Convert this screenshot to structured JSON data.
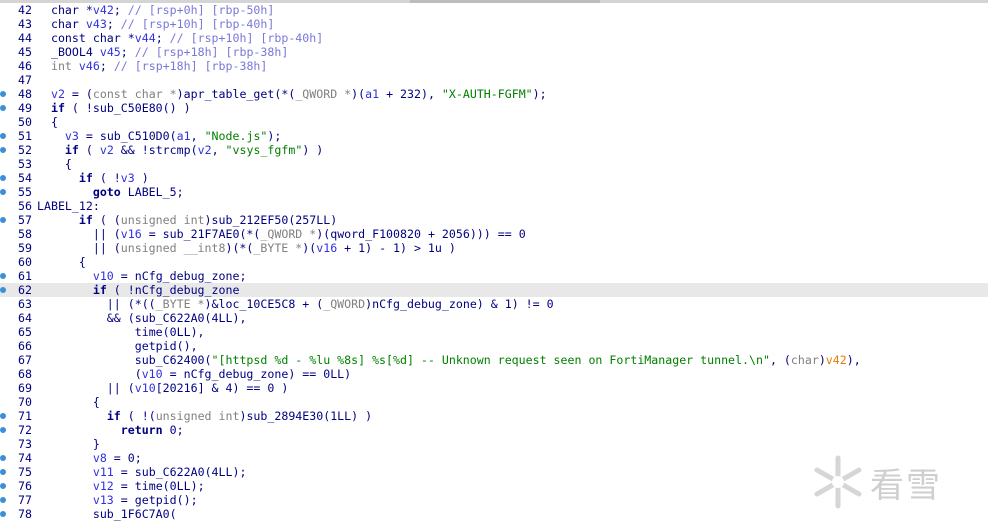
{
  "editor": {
    "watermark_text": "看雪",
    "lines": [
      {
        "n": "42",
        "bp": false,
        "hl": false,
        "html": "  <span class=\"ty\">char</span> *<span class=\"var\">v42</span>; <span class=\"cmt\">// [rsp+0h] [rbp-50h]</span>"
      },
      {
        "n": "43",
        "bp": false,
        "hl": false,
        "html": "  <span class=\"ty\">char</span> <span class=\"var\">v43</span>; <span class=\"cmt\">// [rsp+10h] [rbp-40h]</span>"
      },
      {
        "n": "44",
        "bp": false,
        "hl": false,
        "html": "  <span class=\"ty\">const char</span> *<span class=\"var\">v44</span>; <span class=\"cmt\">// [rsp+10h] [rbp-40h]</span>"
      },
      {
        "n": "45",
        "bp": false,
        "hl": false,
        "html": "  <span class=\"ty\">_BOOL4</span> <span class=\"var\">v45</span>; <span class=\"cmt\">// [rsp+18h] [rbp-38h]</span>"
      },
      {
        "n": "46",
        "bp": false,
        "hl": false,
        "html": "  <span class=\"gray\">int</span> <span class=\"var\">v46</span>; <span class=\"cmt\">// [rsp+18h] [rbp-38h]</span>"
      },
      {
        "n": "47",
        "bp": false,
        "hl": false,
        "html": ""
      },
      {
        "n": "48",
        "bp": true,
        "hl": false,
        "html": "  <span class=\"var\">v2</span> = (<span class=\"gray\">const char *</span>)<span class=\"fn\">apr_table_get</span>(*(<span class=\"gray\">_QWORD *</span>)(<span class=\"arg\">a1</span> + 232), <span class=\"str\">\"X-AUTH-FGFM\"</span>);"
      },
      {
        "n": "49",
        "bp": true,
        "hl": false,
        "html": "  <span class=\"kw\">if</span> ( !<span class=\"fn\">sub_C50E80</span>() )"
      },
      {
        "n": "50",
        "bp": false,
        "hl": false,
        "html": "  {"
      },
      {
        "n": "51",
        "bp": true,
        "hl": false,
        "html": "    <span class=\"var\">v3</span> = <span class=\"fn\">sub_C510D0</span>(<span class=\"arg\">a1</span>, <span class=\"str\">\"Node.js\"</span>);"
      },
      {
        "n": "52",
        "bp": true,
        "hl": false,
        "html": "    <span class=\"kw\">if</span> ( <span class=\"var\">v2</span> &amp;&amp; !<span class=\"fn\">strcmp</span>(<span class=\"var\">v2</span>, <span class=\"str\">\"vsys_fgfm\"</span>) )"
      },
      {
        "n": "53",
        "bp": false,
        "hl": false,
        "html": "    {"
      },
      {
        "n": "54",
        "bp": true,
        "hl": false,
        "html": "      <span class=\"kw\">if</span> ( !<span class=\"var\">v3</span> )"
      },
      {
        "n": "55",
        "bp": true,
        "hl": false,
        "html": "        <span class=\"kw\">goto</span> LABEL_5;"
      },
      {
        "n": "56",
        "bp": false,
        "hl": false,
        "html": "LABEL_12:"
      },
      {
        "n": "57",
        "bp": true,
        "hl": false,
        "html": "      <span class=\"kw\">if</span> ( (<span class=\"gray\">unsigned int</span>)<span class=\"fn\">sub_212EF50</span>(257LL)"
      },
      {
        "n": "58",
        "bp": false,
        "hl": false,
        "html": "        || (<span class=\"var\">v16</span> = <span class=\"fn\">sub_21F7AE0</span>(*(<span class=\"gray\">_QWORD *</span>)(<span class=\"gv\">qword_F100820</span> + 2056))) == 0"
      },
      {
        "n": "59",
        "bp": false,
        "hl": false,
        "html": "        || (<span class=\"gray\">unsigned __int8</span>)(*(<span class=\"gray\">_BYTE *</span>)(<span class=\"var\">v16</span> + 1) - 1) &gt; 1u )"
      },
      {
        "n": "60",
        "bp": false,
        "hl": false,
        "html": "      {"
      },
      {
        "n": "61",
        "bp": true,
        "hl": false,
        "html": "        <span class=\"var\">v10</span> = <span class=\"gv\">nCfg_debug_zone</span>;"
      },
      {
        "n": "62",
        "bp": true,
        "hl": true,
        "html": "        <span class=\"kw\">if</span> ( !<span class=\"gv\">nCfg_debug_zone</span>"
      },
      {
        "n": "63",
        "bp": false,
        "hl": false,
        "html": "          || (*((<span class=\"gray\">_BYTE *</span>)&amp;<span class=\"gv\">loc_10CE5C8</span> + (<span class=\"gray\">_QWORD</span>)<span class=\"gv\">nCfg_debug_zone</span>) &amp; 1) != 0"
      },
      {
        "n": "64",
        "bp": false,
        "hl": false,
        "html": "          &amp;&amp; (<span class=\"fn\">sub_C622A0</span>(4LL),"
      },
      {
        "n": "65",
        "bp": false,
        "hl": false,
        "html": "              <span class=\"fn\">time</span>(0LL),"
      },
      {
        "n": "66",
        "bp": false,
        "hl": false,
        "html": "              <span class=\"fn\">getpid</span>(),"
      },
      {
        "n": "67",
        "bp": false,
        "hl": false,
        "html": "              <span class=\"fn\">sub_C62400</span>(<span class=\"str\">\"[httpsd %d - %lu %8s] %s[%d] -- Unknown request seen on FortiManager tunnel.\\n\"</span>, (<span class=\"gray\">char</span>)<span class=\"orange\">v42</span>),"
      },
      {
        "n": "68",
        "bp": false,
        "hl": false,
        "html": "              (<span class=\"var\">v10</span> = <span class=\"gv\">nCfg_debug_zone</span>) == 0LL)"
      },
      {
        "n": "69",
        "bp": false,
        "hl": false,
        "html": "          || (<span class=\"var\">v10</span>[20216] &amp; 4) == 0 )"
      },
      {
        "n": "70",
        "bp": false,
        "hl": false,
        "html": "        {"
      },
      {
        "n": "71",
        "bp": true,
        "hl": false,
        "html": "          <span class=\"kw\">if</span> ( !(<span class=\"gray\">unsigned int</span>)<span class=\"fn\">sub_2894E30</span>(1LL) )"
      },
      {
        "n": "72",
        "bp": true,
        "hl": false,
        "html": "            <span class=\"kw\">return</span> 0;"
      },
      {
        "n": "73",
        "bp": false,
        "hl": false,
        "html": "        }"
      },
      {
        "n": "74",
        "bp": true,
        "hl": false,
        "html": "        <span class=\"var\">v8</span> = 0;"
      },
      {
        "n": "75",
        "bp": true,
        "hl": false,
        "html": "        <span class=\"var\">v11</span> = <span class=\"fn\">sub_C622A0</span>(4LL);"
      },
      {
        "n": "76",
        "bp": true,
        "hl": false,
        "html": "        <span class=\"var\">v12</span> = <span class=\"fn\">time</span>(0LL);"
      },
      {
        "n": "77",
        "bp": true,
        "hl": false,
        "html": "        <span class=\"var\">v13</span> = <span class=\"fn\">getpid</span>();"
      },
      {
        "n": "78",
        "bp": true,
        "hl": false,
        "html": "        <span class=\"fn\">sub_1F6C7A0</span>("
      }
    ]
  }
}
